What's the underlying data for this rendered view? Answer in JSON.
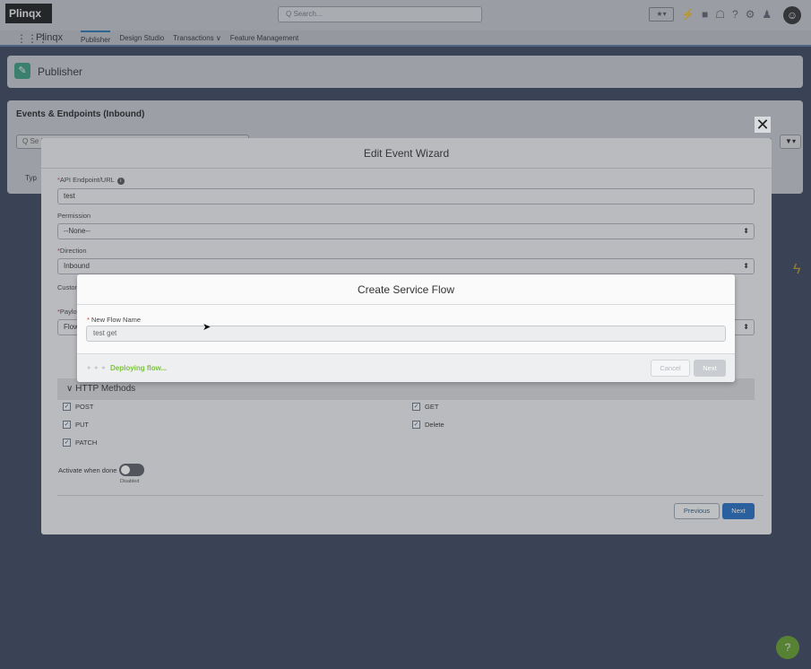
{
  "header": {
    "logo_text": "Plinqx",
    "search_placeholder": "Q Search...",
    "favorites_label": "★▾",
    "icons": [
      "bolt-icon",
      "add-icon",
      "bell-icon",
      "help-icon",
      "gear-icon",
      "notification-icon"
    ]
  },
  "nav": {
    "app_name": "Plinqx",
    "items": [
      {
        "label": "Publisher"
      },
      {
        "label": "Design Studio"
      },
      {
        "label": "Transactions ∨"
      },
      {
        "label": "Feature Management"
      }
    ]
  },
  "page": {
    "title": "Publisher"
  },
  "events": {
    "title": "Events & Endpoints (Inbound)",
    "search_placeholder": "Q Se",
    "type_column": "Typ",
    "filter_label": "▼▾"
  },
  "wizard": {
    "title": "Edit Event Wizard",
    "api_endpoint_label": "API Endpoint/URL",
    "api_endpoint_value": "test",
    "permission_label": "Permission",
    "permission_value": "--None--",
    "direction_label": "Direction",
    "direction_value": "Inbound",
    "custom_label_partial": "Custon",
    "payload_label_partial": "Paylo",
    "flow_value_partial": "Flow",
    "http_methods_title": "HTTP Methods",
    "methods": [
      {
        "label": "POST",
        "checked": true
      },
      {
        "label": "GET",
        "checked": true
      },
      {
        "label": "PUT",
        "checked": true
      },
      {
        "label": "Delete",
        "checked": true
      },
      {
        "label": "PATCH",
        "checked": true
      }
    ],
    "activate_label": "Activate when done",
    "activate_state": "Disabled",
    "previous_label": "Previous",
    "next_label": "Next"
  },
  "modal": {
    "title": "Create Service Flow",
    "flow_name_label": "New Flow Name",
    "flow_name_value": "test get",
    "status_text": "Deploying flow...",
    "cancel_label": "Cancel",
    "next_label": "Next"
  },
  "colors": {
    "primary_blue": "#236cbf",
    "status_green": "#7cc33c",
    "page_icon_green": "#3ea585"
  }
}
